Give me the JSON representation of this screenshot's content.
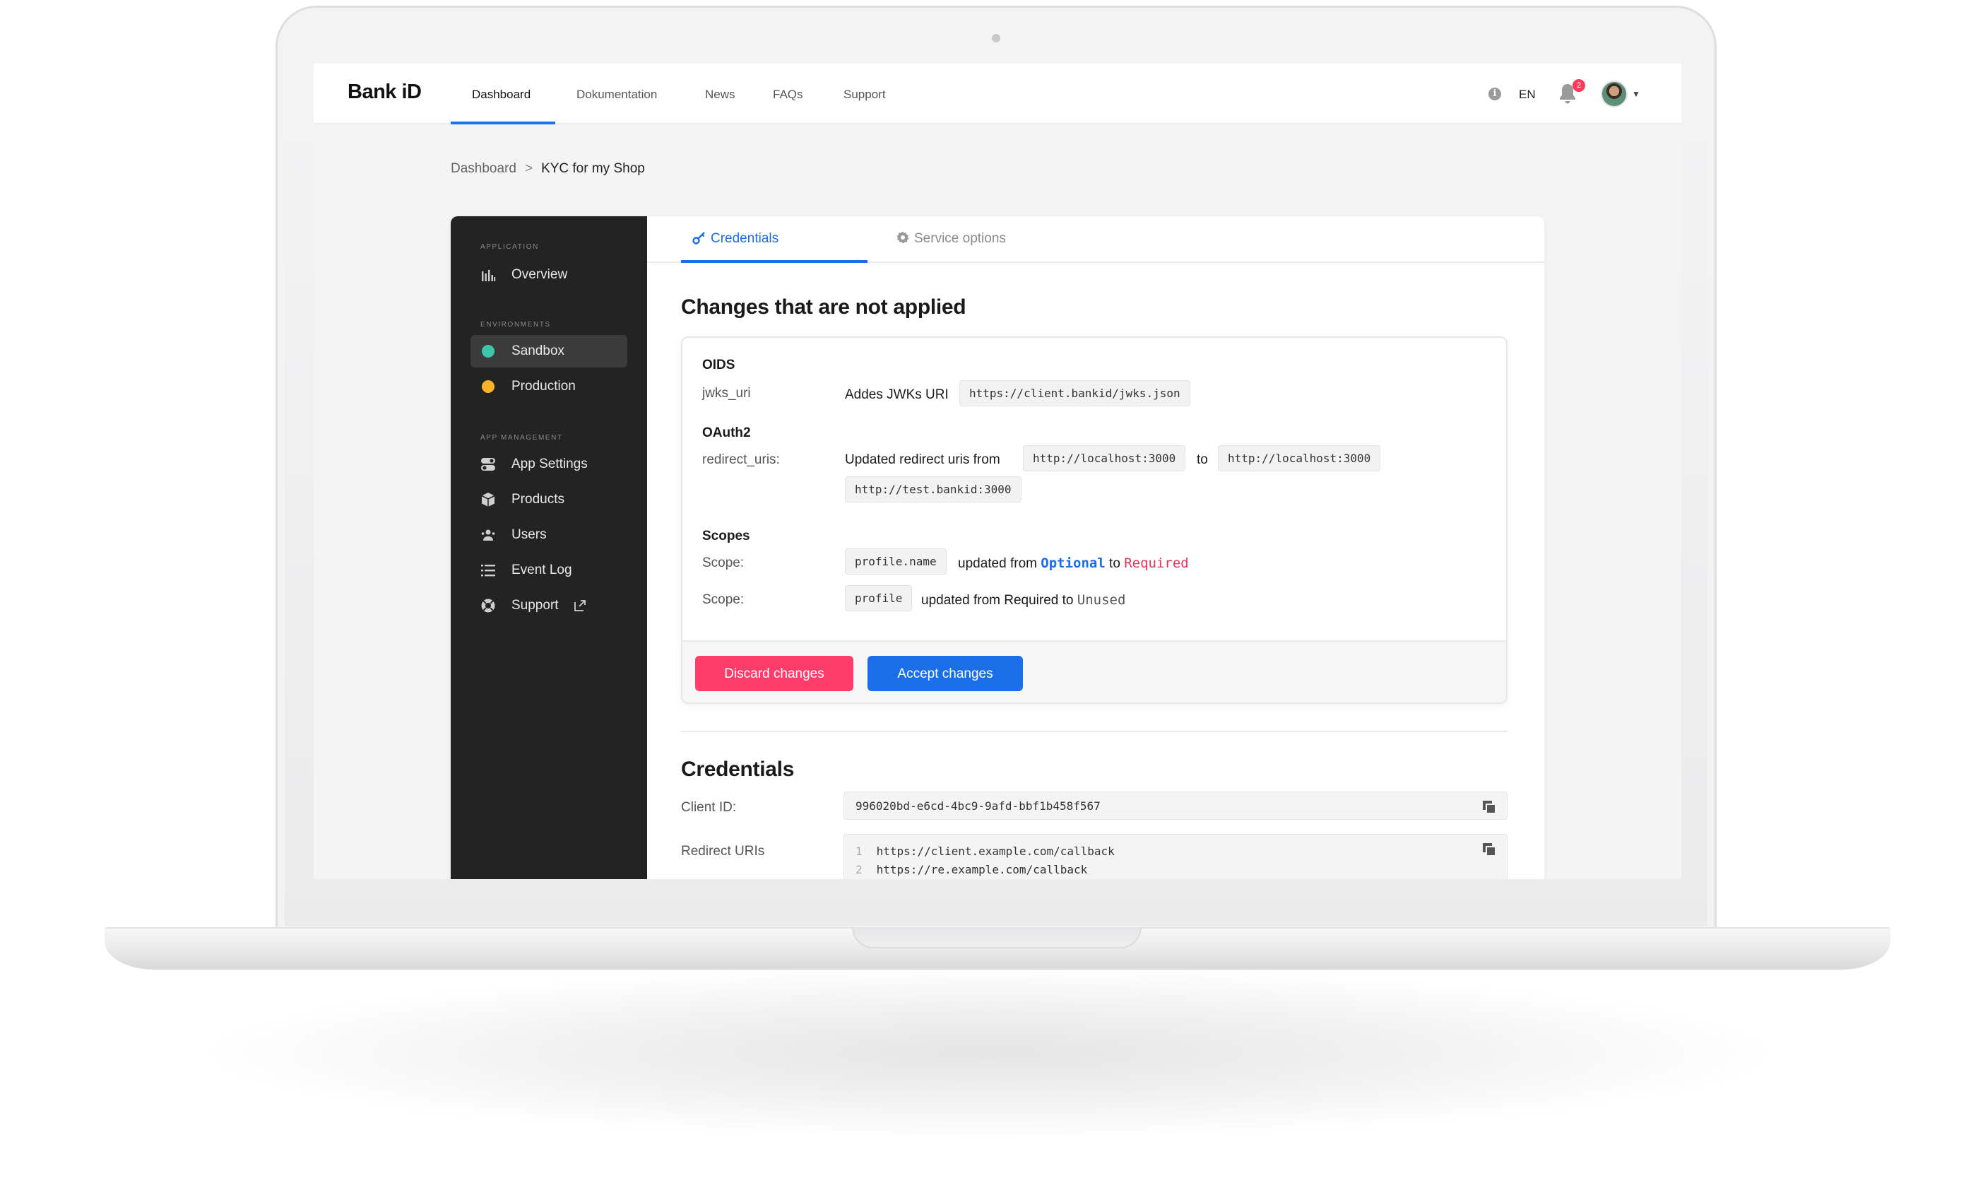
{
  "topnav": {
    "logo": "Bank iD",
    "tabs": [
      "Dashboard",
      "Dokumentation",
      "News",
      "FAQs",
      "Support"
    ],
    "active_tab": "Dashboard",
    "language": "EN",
    "notification_count": "2"
  },
  "breadcrumb": {
    "root": "Dashboard",
    "separator": ">",
    "current": "KYC for my Shop"
  },
  "sidebar": {
    "sections": [
      {
        "title": "APPLICATION",
        "items": [
          {
            "label": "Overview",
            "icon": "bar-chart-icon"
          }
        ]
      },
      {
        "title": "ENVIRONMENTS",
        "items": [
          {
            "label": "Sandbox",
            "icon": "status-dot",
            "color": "#3ec6a8",
            "active": true
          },
          {
            "label": "Production",
            "icon": "status-dot",
            "color": "#f8b32a"
          }
        ]
      },
      {
        "title": "APP MANAGEMENT",
        "items": [
          {
            "label": "App Settings",
            "icon": "toggle-icon"
          },
          {
            "label": "Products",
            "icon": "box-icon"
          },
          {
            "label": "Users",
            "icon": "users-icon"
          },
          {
            "label": "Event Log",
            "icon": "list-icon"
          },
          {
            "label": "Support",
            "icon": "lifebuoy-icon",
            "external": true
          }
        ]
      }
    ]
  },
  "tabs": {
    "credentials": "Credentials",
    "service_options": "Service options"
  },
  "changes": {
    "title": "Changes that are not applied",
    "oids": {
      "group": "OIDS",
      "key": "jwks_uri",
      "text": "Addes JWKs URI",
      "value": "https://client.bankid/jwks.json"
    },
    "oauth2": {
      "group": "OAuth2",
      "key": "redirect_uris:",
      "text_from": "Updated redirect uris from",
      "from": "http://localhost:3000",
      "to_word": "to",
      "to": "http://localhost:3000",
      "to_extra": "http://test.bankid:3000"
    },
    "scopes": {
      "group": "Scopes",
      "rows": [
        {
          "key": "Scope:",
          "scope": "profile.name",
          "text": "updated from",
          "from": "Optional",
          "to_word": "to",
          "to": "Required"
        },
        {
          "key": "Scope:",
          "scope": "profile",
          "text": "updated from Required to",
          "to": "Unused"
        }
      ]
    },
    "discard_label": "Discard changes",
    "accept_label": "Accept changes"
  },
  "credentials": {
    "title": "Credentials",
    "client_id_label": "Client ID:",
    "client_id": "996020bd-e6cd-4bc9-9afd-bbf1b458f567",
    "redirect_label": "Redirect URIs",
    "redirect_uris": [
      {
        "n": "1",
        "uri": "https://client.example.com/callback"
      },
      {
        "n": "2",
        "uri": "https://re.example.com/callback"
      }
    ]
  },
  "colors": {
    "accent": "#1a6fe8",
    "danger": "#ff3d6a",
    "sidebar_bg": "#232323"
  }
}
